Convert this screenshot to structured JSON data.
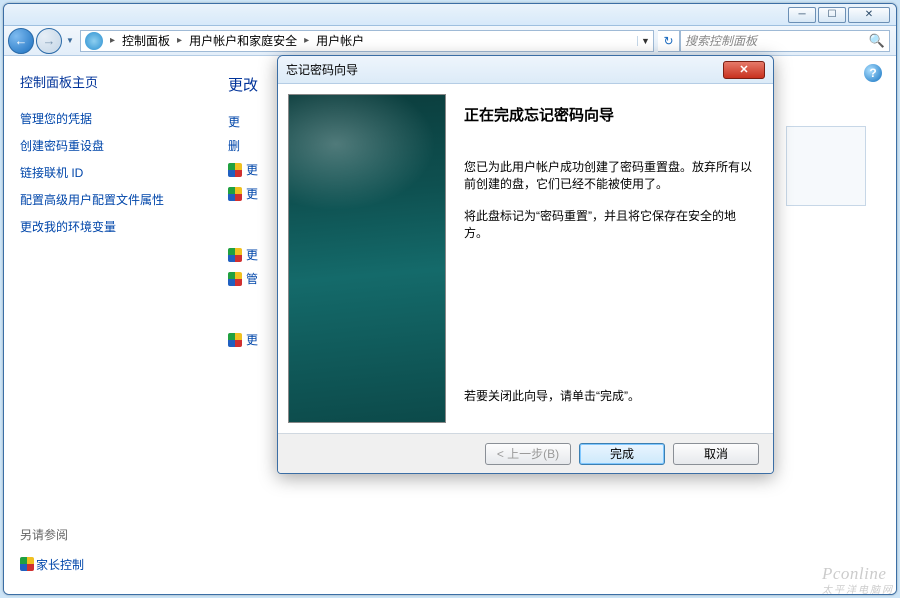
{
  "titlebar": {
    "min_glyph": "─",
    "max_glyph": "☐",
    "close_glyph": "✕"
  },
  "nav": {
    "back_glyph": "←",
    "fwd_glyph": "→",
    "drop_glyph": "▼",
    "refresh_glyph": "↻"
  },
  "breadcrumb": {
    "items": [
      "控制面板",
      "用户帐户和家庭安全",
      "用户帐户"
    ],
    "arrow": "▸"
  },
  "search": {
    "placeholder": "搜索控制面板",
    "icon": "🔍"
  },
  "sidebar": {
    "title": "控制面板主页",
    "links": [
      {
        "label": "管理您的凭据",
        "shield": false
      },
      {
        "label": "创建密码重设盘",
        "shield": false
      },
      {
        "label": "链接联机 ID",
        "shield": false
      },
      {
        "label": "配置高级用户配置文件属性",
        "shield": false
      },
      {
        "label": "更改我的环境变量",
        "shield": false
      }
    ],
    "see_also": "另请参阅",
    "parental": "家长控制"
  },
  "main": {
    "heading": "更改",
    "help_glyph": "?",
    "rows": [
      {
        "label": "更",
        "shield": false
      },
      {
        "label": "删",
        "shield": false
      },
      {
        "label": "更",
        "shield": true
      },
      {
        "label": "更",
        "shield": true
      },
      {
        "label": "更",
        "shield": true
      },
      {
        "label": "管",
        "shield": true
      },
      {
        "label": "更",
        "shield": true
      }
    ]
  },
  "wizard": {
    "title": "忘记密码向导",
    "close_glyph": "✕",
    "heading": "正在完成忘记密码向导",
    "p1": "您已为此用户帐户成功创建了密码重置盘。放弃所有以前创建的盘，它们已经不能被使用了。",
    "p2": "将此盘标记为“密码重置”，并且将它保存在安全的地方。",
    "p3": "若要关闭此向导，请单击“完成”。",
    "btn_back": "< 上一步(B)",
    "btn_finish": "完成",
    "btn_cancel": "取消"
  },
  "watermark": {
    "line1": "Pconline",
    "line2": "太平洋电脑网"
  }
}
